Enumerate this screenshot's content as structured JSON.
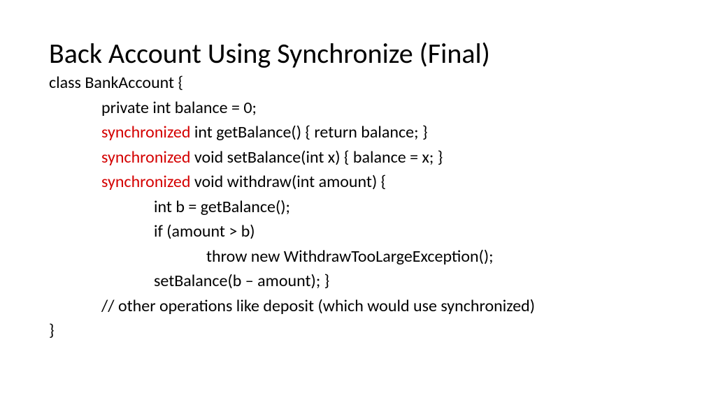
{
  "title": "Back Account Using Synchronize (Final)",
  "code": {
    "l1": "class BankAccount {",
    "l2": "private int balance = 0;",
    "l3a": "synchronized",
    "l3b": " int getBalance() { return balance; }",
    "l4a": "synchronized",
    "l4b": " void setBalance(int x) { balance = x; }",
    "l5a": "synchronized",
    "l5b": " void withdraw(int amount) {",
    "l6": "int b = getBalance();",
    "l7": "if (amount > b)",
    "l8": "throw new WithdrawTooLargeException();",
    "l9": "setBalance(b – amount); }",
    "l10": "// other operations like deposit (which would use synchronized)",
    "l11": "}"
  }
}
